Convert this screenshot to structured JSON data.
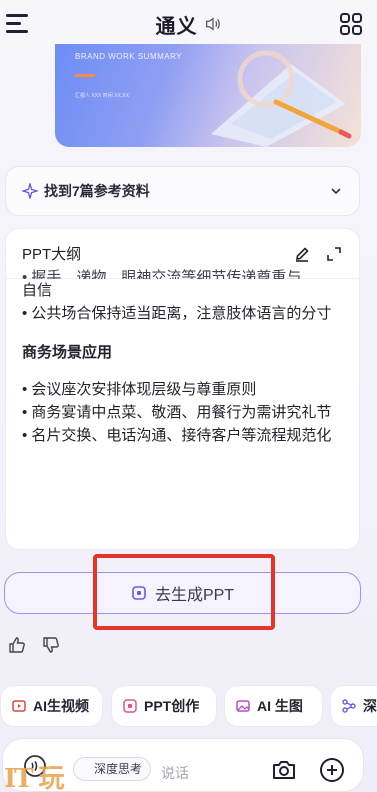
{
  "header": {
    "title": "通义",
    "menu_icon": "hamburger-menu-icon",
    "right_icon": "grid-apps-icon"
  },
  "banner": {
    "heading": "BRAND WORK SUMMARY",
    "meta": "汇报人  XXX 时间  XX.XX"
  },
  "references": {
    "label": "找到7篇参考资料"
  },
  "outline": {
    "title": "PPT大纲",
    "cut_line": "• 握手、递物、眼神交流等细节传递尊重与",
    "lines": [
      "自信",
      "• 公共场合保持适当距离，注意肢体语言的分寸"
    ],
    "section": "商务场景应用",
    "section_lines": [
      "• 会议座次安排体现层级与尊重原则",
      "• 商务宴请中点菜、敬酒、用餐行为需讲究礼节",
      "• 名片交换、电话沟通、接待客户等流程规范化"
    ]
  },
  "generate": {
    "label": "去生成PPT"
  },
  "chips": [
    {
      "label": "AI生视频",
      "icon": "video-icon"
    },
    {
      "label": "PPT创作",
      "icon": "ppt-icon"
    },
    {
      "label": "AI 生图",
      "icon": "image-icon"
    },
    {
      "label": "深",
      "icon": "nodes-icon"
    }
  ],
  "input": {
    "deep_think": "深度思考",
    "placeholder": "说话"
  },
  "watermark": "IT 玩",
  "colors": {
    "accent": "#9b95e8",
    "highlight": "#e5342b"
  }
}
